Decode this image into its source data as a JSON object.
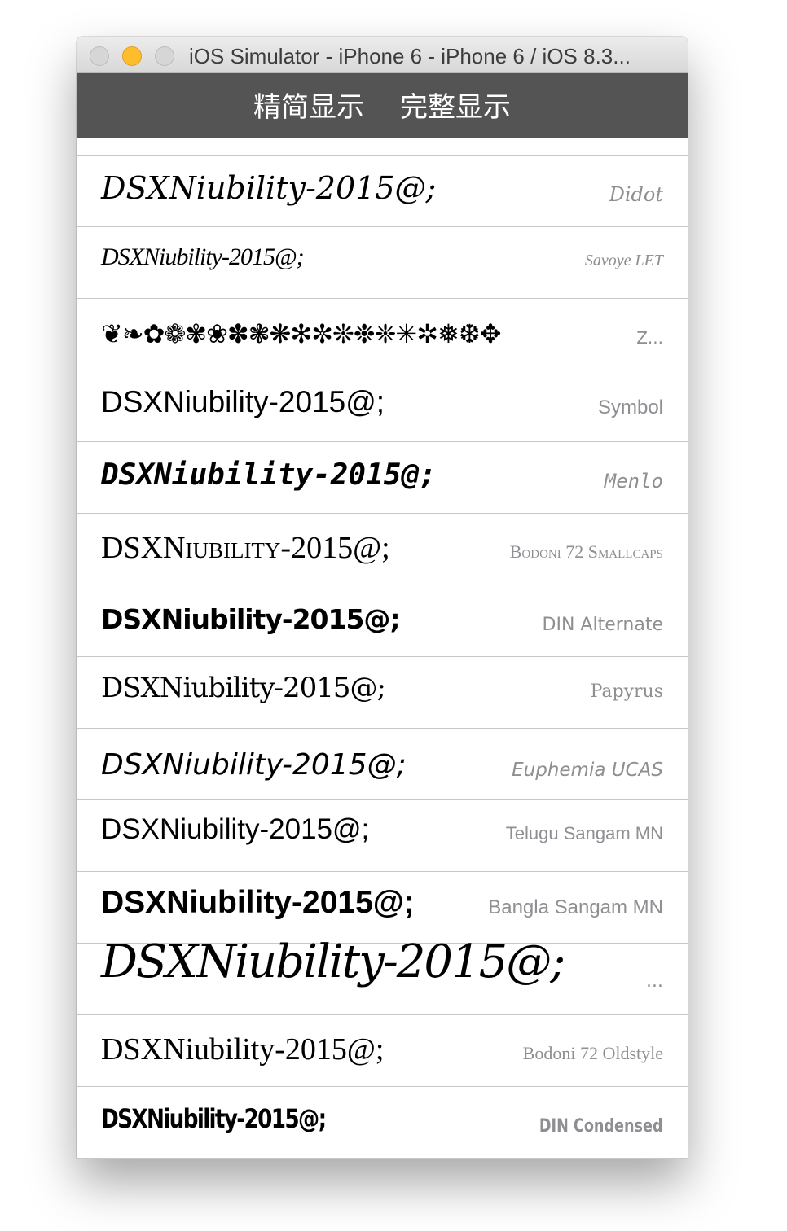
{
  "window": {
    "title": "iOS Simulator - iPhone 6 - iPhone 6 / iOS 8.3..."
  },
  "navbar": {
    "simple_label": "精简显示",
    "full_label": "完整显示",
    "background": "#545454"
  },
  "rows": [
    {
      "sample": "DSXNiubility-2015@;",
      "font_name": "Didot"
    },
    {
      "sample": "DSXNiubility-2015@;",
      "font_name": "Savoye LET"
    },
    {
      "sample": "❦❧✿❁✾❀✽❃❋✻✼❊❉❈✳✲❅❆✥",
      "font_name": "Z..."
    },
    {
      "sample": "DSXNiubility-2015@;",
      "font_name": "Symbol"
    },
    {
      "sample": "DSXNiubility-2015@;",
      "font_name": "Menlo"
    },
    {
      "sample": "DSXNiubility-2015@;",
      "font_name": "Bodoni 72 Smallcaps"
    },
    {
      "sample": "DSXNiubility-2015@;",
      "font_name": "DIN Alternate"
    },
    {
      "sample": "DSXNiubility-2015@;",
      "font_name": "Papyrus"
    },
    {
      "sample": "DSXNiubility-2015@;",
      "font_name": "Euphemia UCAS"
    },
    {
      "sample": "DSXNiubility-2015@;",
      "font_name": "Telugu Sangam MN"
    },
    {
      "sample": "DSXNiubility-2015@;",
      "font_name": "Bangla Sangam MN"
    },
    {
      "sample": "DSXNiubility-2015@;",
      "font_name": "..."
    },
    {
      "sample": "DSXNiubility-2015@;",
      "font_name": "Bodoni 72 Oldstyle"
    },
    {
      "sample": "DSXNiubility-2015@;",
      "font_name": "DIN Condensed"
    }
  ]
}
